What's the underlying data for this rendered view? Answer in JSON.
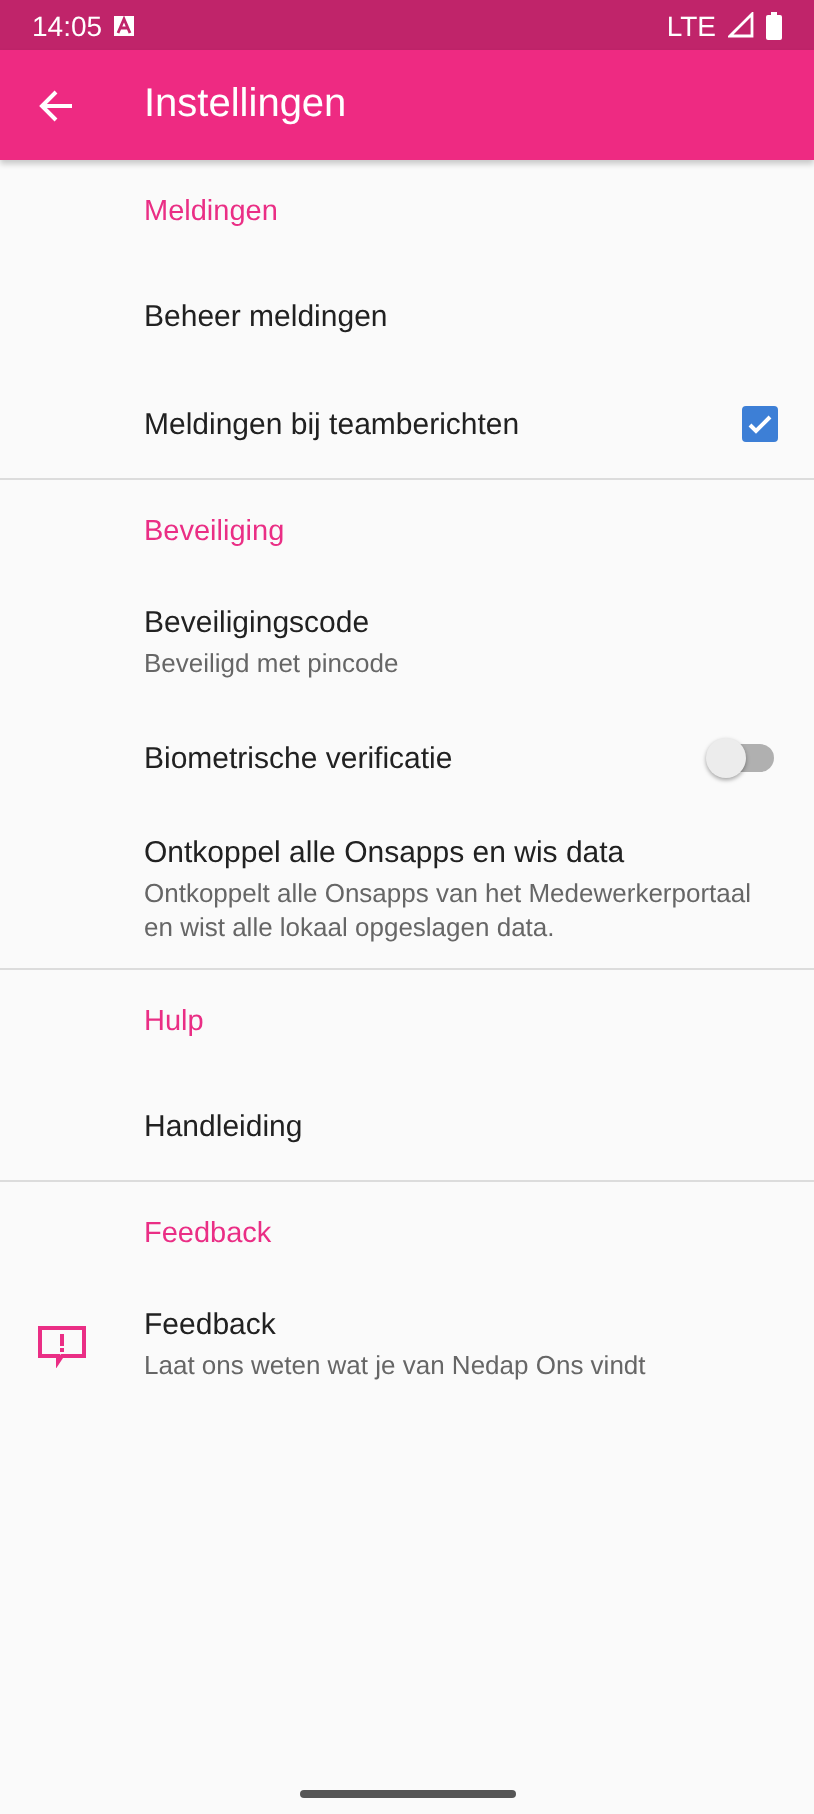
{
  "status_bar": {
    "time": "14:05",
    "network": "LTE"
  },
  "toolbar": {
    "title": "Instellingen"
  },
  "sections": [
    {
      "title": "Meldingen",
      "items": [
        {
          "kind": "plain",
          "title": "Beheer meldingen"
        },
        {
          "kind": "checkbox",
          "title": "Meldingen bij teamberichten",
          "checked": true
        }
      ]
    },
    {
      "title": "Beveiliging",
      "items": [
        {
          "kind": "plain",
          "title": "Beveiligingscode",
          "summary": "Beveiligd met pincode"
        },
        {
          "kind": "switch",
          "title": "Biometrische verificatie",
          "on": false
        },
        {
          "kind": "plain",
          "title": "Ontkoppel alle Onsapps en wis data",
          "summary": "Ontkoppelt alle Onsapps van het Medewerkerportaal en wist alle lokaal opgeslagen data."
        }
      ]
    },
    {
      "title": "Hulp",
      "items": [
        {
          "kind": "plain",
          "title": "Handleiding"
        }
      ]
    },
    {
      "title": "Feedback",
      "items": [
        {
          "kind": "icon",
          "title": "Feedback",
          "summary": "Laat ons weten wat je van Nedap Ons vindt"
        }
      ]
    }
  ]
}
